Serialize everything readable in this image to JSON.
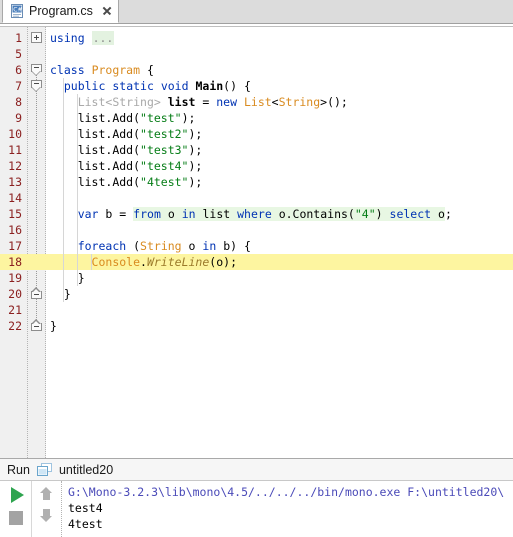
{
  "window": {
    "title": "Program.cs"
  },
  "tabbar": {
    "tabs": [
      {
        "label": "Program.cs",
        "icon": "csharp-file-icon",
        "close_icon": "close-icon"
      }
    ]
  },
  "editor": {
    "current_line": 18,
    "lines": [
      {
        "num": "1",
        "fold": "plus",
        "indent": 0,
        "html": "<span class=\"kw\">using</span> <span class=\"usingfold\">...</span>"
      },
      {
        "num": "5",
        "fold": "",
        "indent": 0,
        "html": ""
      },
      {
        "num": "6",
        "fold": "regionTop",
        "indent": 0,
        "html": "<span class=\"kw\">class</span> <span class=\"cls\">Program</span> <span class=\"punct\">{</span>"
      },
      {
        "num": "7",
        "fold": "regionTop",
        "indent": 1,
        "html": "  <span class=\"kw\">public</span> <span class=\"kw\">static</span> <span class=\"kw\">void</span> <span class=\"idb\">Main</span><span class=\"punct\">() {</span>"
      },
      {
        "num": "8",
        "fold": "",
        "indent": 2,
        "html": "    <span class=\"typeDim\">List&lt;String&gt;</span> <span class=\"idb\">list</span> <span class=\"punct\">=</span> <span class=\"kw\">new</span> <span class=\"type\">List</span><span class=\"punct\">&lt;</span><span class=\"type\">String</span><span class=\"punct\">&gt;();</span>"
      },
      {
        "num": "9",
        "fold": "",
        "indent": 2,
        "html": "    <span class=\"id\">list.Add(</span><span class=\"str\">\"test\"</span><span class=\"punct\">);</span>"
      },
      {
        "num": "10",
        "fold": "",
        "indent": 2,
        "html": "    <span class=\"id\">list.Add(</span><span class=\"str\">\"test2\"</span><span class=\"punct\">);</span>"
      },
      {
        "num": "11",
        "fold": "",
        "indent": 2,
        "html": "    <span class=\"id\">list.Add(</span><span class=\"str\">\"test3\"</span><span class=\"punct\">);</span>"
      },
      {
        "num": "12",
        "fold": "",
        "indent": 2,
        "html": "    <span class=\"id\">list.Add(</span><span class=\"str\">\"test4\"</span><span class=\"punct\">);</span>"
      },
      {
        "num": "13",
        "fold": "",
        "indent": 2,
        "html": "    <span class=\"id\">list.Add(</span><span class=\"str\">\"4test\"</span><span class=\"punct\">);</span>"
      },
      {
        "num": "14",
        "fold": "",
        "indent": 2,
        "html": ""
      },
      {
        "num": "15",
        "fold": "",
        "indent": 2,
        "html": "    <span class=\"kw\">var</span> <span class=\"id\">b</span> <span class=\"punct\">=</span> <span class=\"linq\"><span class=\"kw\">from</span> <span class=\"id\">o</span> <span class=\"kw\">in</span> <span class=\"id\">list</span> <span class=\"kw\">where</span> <span class=\"id\">o.Contains(</span><span class=\"str\">\"4\"</span><span class=\"id\">)</span> <span class=\"kw\">select</span> <span class=\"id\">o</span></span><span class=\"punct\">;</span>"
      },
      {
        "num": "16",
        "fold": "",
        "indent": 2,
        "html": ""
      },
      {
        "num": "17",
        "fold": "",
        "indent": 2,
        "html": "    <span class=\"kw\">foreach</span> <span class=\"punct\">(</span><span class=\"type\">String</span> <span class=\"id\">o</span> <span class=\"kw\">in</span> <span class=\"id\">b</span><span class=\"punct\">) {</span>"
      },
      {
        "num": "18",
        "fold": "",
        "indent": 3,
        "html": "      <span class=\"cls\">Console</span><span class=\"punct\">.</span><span class=\"mth\">WriteLine</span><span class=\"punct\">(</span><span class=\"id\">o</span><span class=\"punct\">);</span>"
      },
      {
        "num": "19",
        "fold": "",
        "indent": 2,
        "html": "    <span class=\"punct\">}</span>"
      },
      {
        "num": "20",
        "fold": "endUp",
        "indent": 1,
        "html": "  <span class=\"punct\">}</span>"
      },
      {
        "num": "21",
        "fold": "",
        "indent": 0,
        "html": ""
      },
      {
        "num": "22",
        "fold": "endUp",
        "indent": 0,
        "html": "<span class=\"punct\">}</span>"
      }
    ]
  },
  "run_panel": {
    "title": "Run",
    "tab_icon": "run-config-icon",
    "tab_label": "untitled20",
    "toolbar": {
      "play_label": "Run",
      "stop_label": "Stop",
      "up_label": "Previous occurrence",
      "down_label": "Next occurrence"
    },
    "console": {
      "lines": [
        {
          "text": "G:\\Mono-3.2.3\\lib\\mono\\4.5/../../../bin/mono.exe F:\\untitled20\\",
          "kind": "cmd"
        },
        {
          "text": "test4",
          "kind": "out"
        },
        {
          "text": "4test",
          "kind": "out"
        }
      ]
    }
  },
  "colors": {
    "keyword": "#0033b3",
    "string": "#067d17",
    "type": "#d98b20",
    "line_number": "#8b2020",
    "current_line_bg": "#fdf5a0",
    "linq_bg": "#e8f7e3",
    "play_green": "#2ea44f",
    "stop_gray": "#a3a3a3"
  }
}
